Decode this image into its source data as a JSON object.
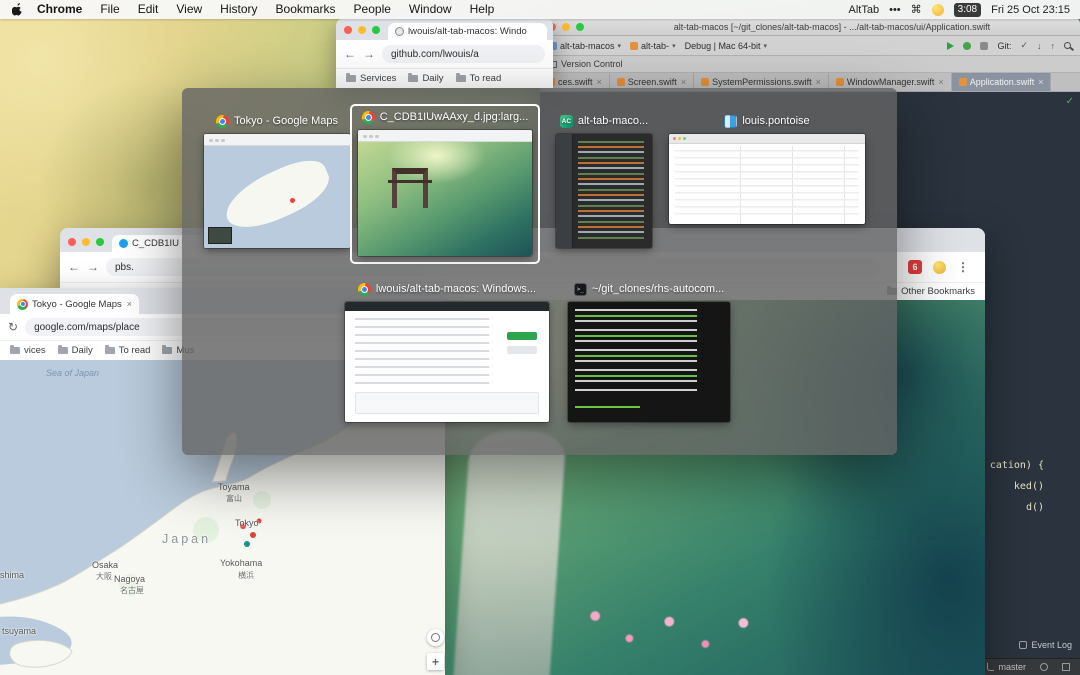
{
  "icons": {
    "back": "←",
    "forward": "→",
    "refresh": "↻",
    "vdots": "⋮",
    "caret": "▾",
    "close": "×",
    "check": "✓",
    "down": "↓",
    "up": "↑",
    "command": "⌘"
  },
  "menu_bar": {
    "app": "Chrome",
    "menus": [
      "File",
      "Edit",
      "View",
      "History",
      "Bookmarks",
      "People",
      "Window",
      "Help"
    ],
    "alttab": "AltTab",
    "dots": "•••",
    "time_badge": "3:08",
    "clock": "Fri 25 Oct 23:15"
  },
  "github_window": {
    "tab_title": "lwouis/alt-tab-macos: Windo",
    "url": "github.com/lwouis/a",
    "bookmarks": [
      "Services",
      "Daily",
      "To read"
    ]
  },
  "image_window": {
    "tab_title": "C_CDB1IU",
    "url": "pbs.",
    "ext_badge": "6",
    "other_bookmarks": "Other Bookmarks"
  },
  "tokyo_window": {
    "tab_title": "Tokyo - Google Maps",
    "url": "google.com/maps/place",
    "bookmarks": [
      "vices",
      "Daily",
      "To read",
      "Mus"
    ],
    "map": {
      "sea_label": "Sea of Japan",
      "country": "Japan",
      "toyama": "Toyama",
      "toyama_k": "富山",
      "tokyo": "Tokyo",
      "yokohama": "Yokohama",
      "yokohama_k": "横浜",
      "osaka": "Osaka",
      "osaka_k": "大阪",
      "nagoya": "Nagoya",
      "nagoya_k": "名古屋",
      "shima": "shima",
      "tsuyama": "tsuyama",
      "zoom_in": "+"
    }
  },
  "appcode": {
    "title": "alt-tab-macos [~/git_clones/alt-tab-macos] - .../alt-tab-macos/ui/Application.swift",
    "project": "alt-tab-macos",
    "run_config": "alt-tab-",
    "build_config": "Debug | Mac 64-bit",
    "git_label": "Git:",
    "version_control": "Version Control",
    "tabs": [
      "ces.swift",
      "Screen.swift",
      "SystemPermissions.swift",
      "WindowManager.swift",
      "Application.swift"
    ],
    "code": [
      "cation) {",
      "ked()",
      "d()"
    ],
    "event_log": "Event Log",
    "branch": "master"
  },
  "switcher": {
    "ac_text": "AC",
    "term_text": ">_",
    "items": [
      {
        "title": "Tokyo - Google Maps"
      },
      {
        "title": "C_CDB1IUwAAxy_d.jpg:larg..."
      },
      {
        "title": "alt-tab-maco..."
      },
      {
        "title": "louis.pontoise"
      },
      {
        "title": "lwouis/alt-tab-macos: Windows..."
      },
      {
        "title": "~/git_clones/rhs-autocom..."
      }
    ]
  }
}
